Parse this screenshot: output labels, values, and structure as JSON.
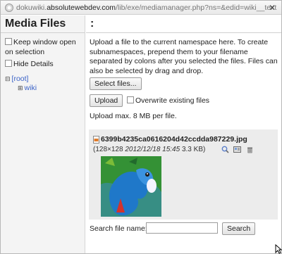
{
  "window": {
    "url_prefix": "dokuwiki.",
    "url_domain": "absolutewebdev.com",
    "url_path": "/lib/exe/mediamanager.php?ns=&edid=wiki__text",
    "close_glyph": "✕"
  },
  "sidebar": {
    "title": "Media Files",
    "options": [
      {
        "label": "Keep window open on selection",
        "checked": false
      },
      {
        "label": "Hide Details",
        "checked": false
      }
    ],
    "tree": {
      "root": "[root]",
      "children": [
        "wiki"
      ]
    }
  },
  "main": {
    "title": ":",
    "description": "Upload a file to the current namespace here. To create subnamespaces, prepend them to your filename separated by colons after you selected the files. Files can also be selected by drag and drop.",
    "select_files_label": "Select files...",
    "upload_label": "Upload",
    "overwrite_label": "Overwrite existing files",
    "max_size_text": "Upload max. 8 MB per file.",
    "file": {
      "name": "6399b4235ca0616204d42ccdda987229.jpg",
      "dimensions": "(128×128",
      "date": "2012/12/18 15:45",
      "size": "3.3 KB)"
    },
    "search_label": "Search file name:",
    "search_value": "",
    "search_button": "Search"
  },
  "colors": {
    "link": "#3a62c7",
    "sidebar_bg": "#f4f4f4",
    "card_bg": "#ececec"
  }
}
